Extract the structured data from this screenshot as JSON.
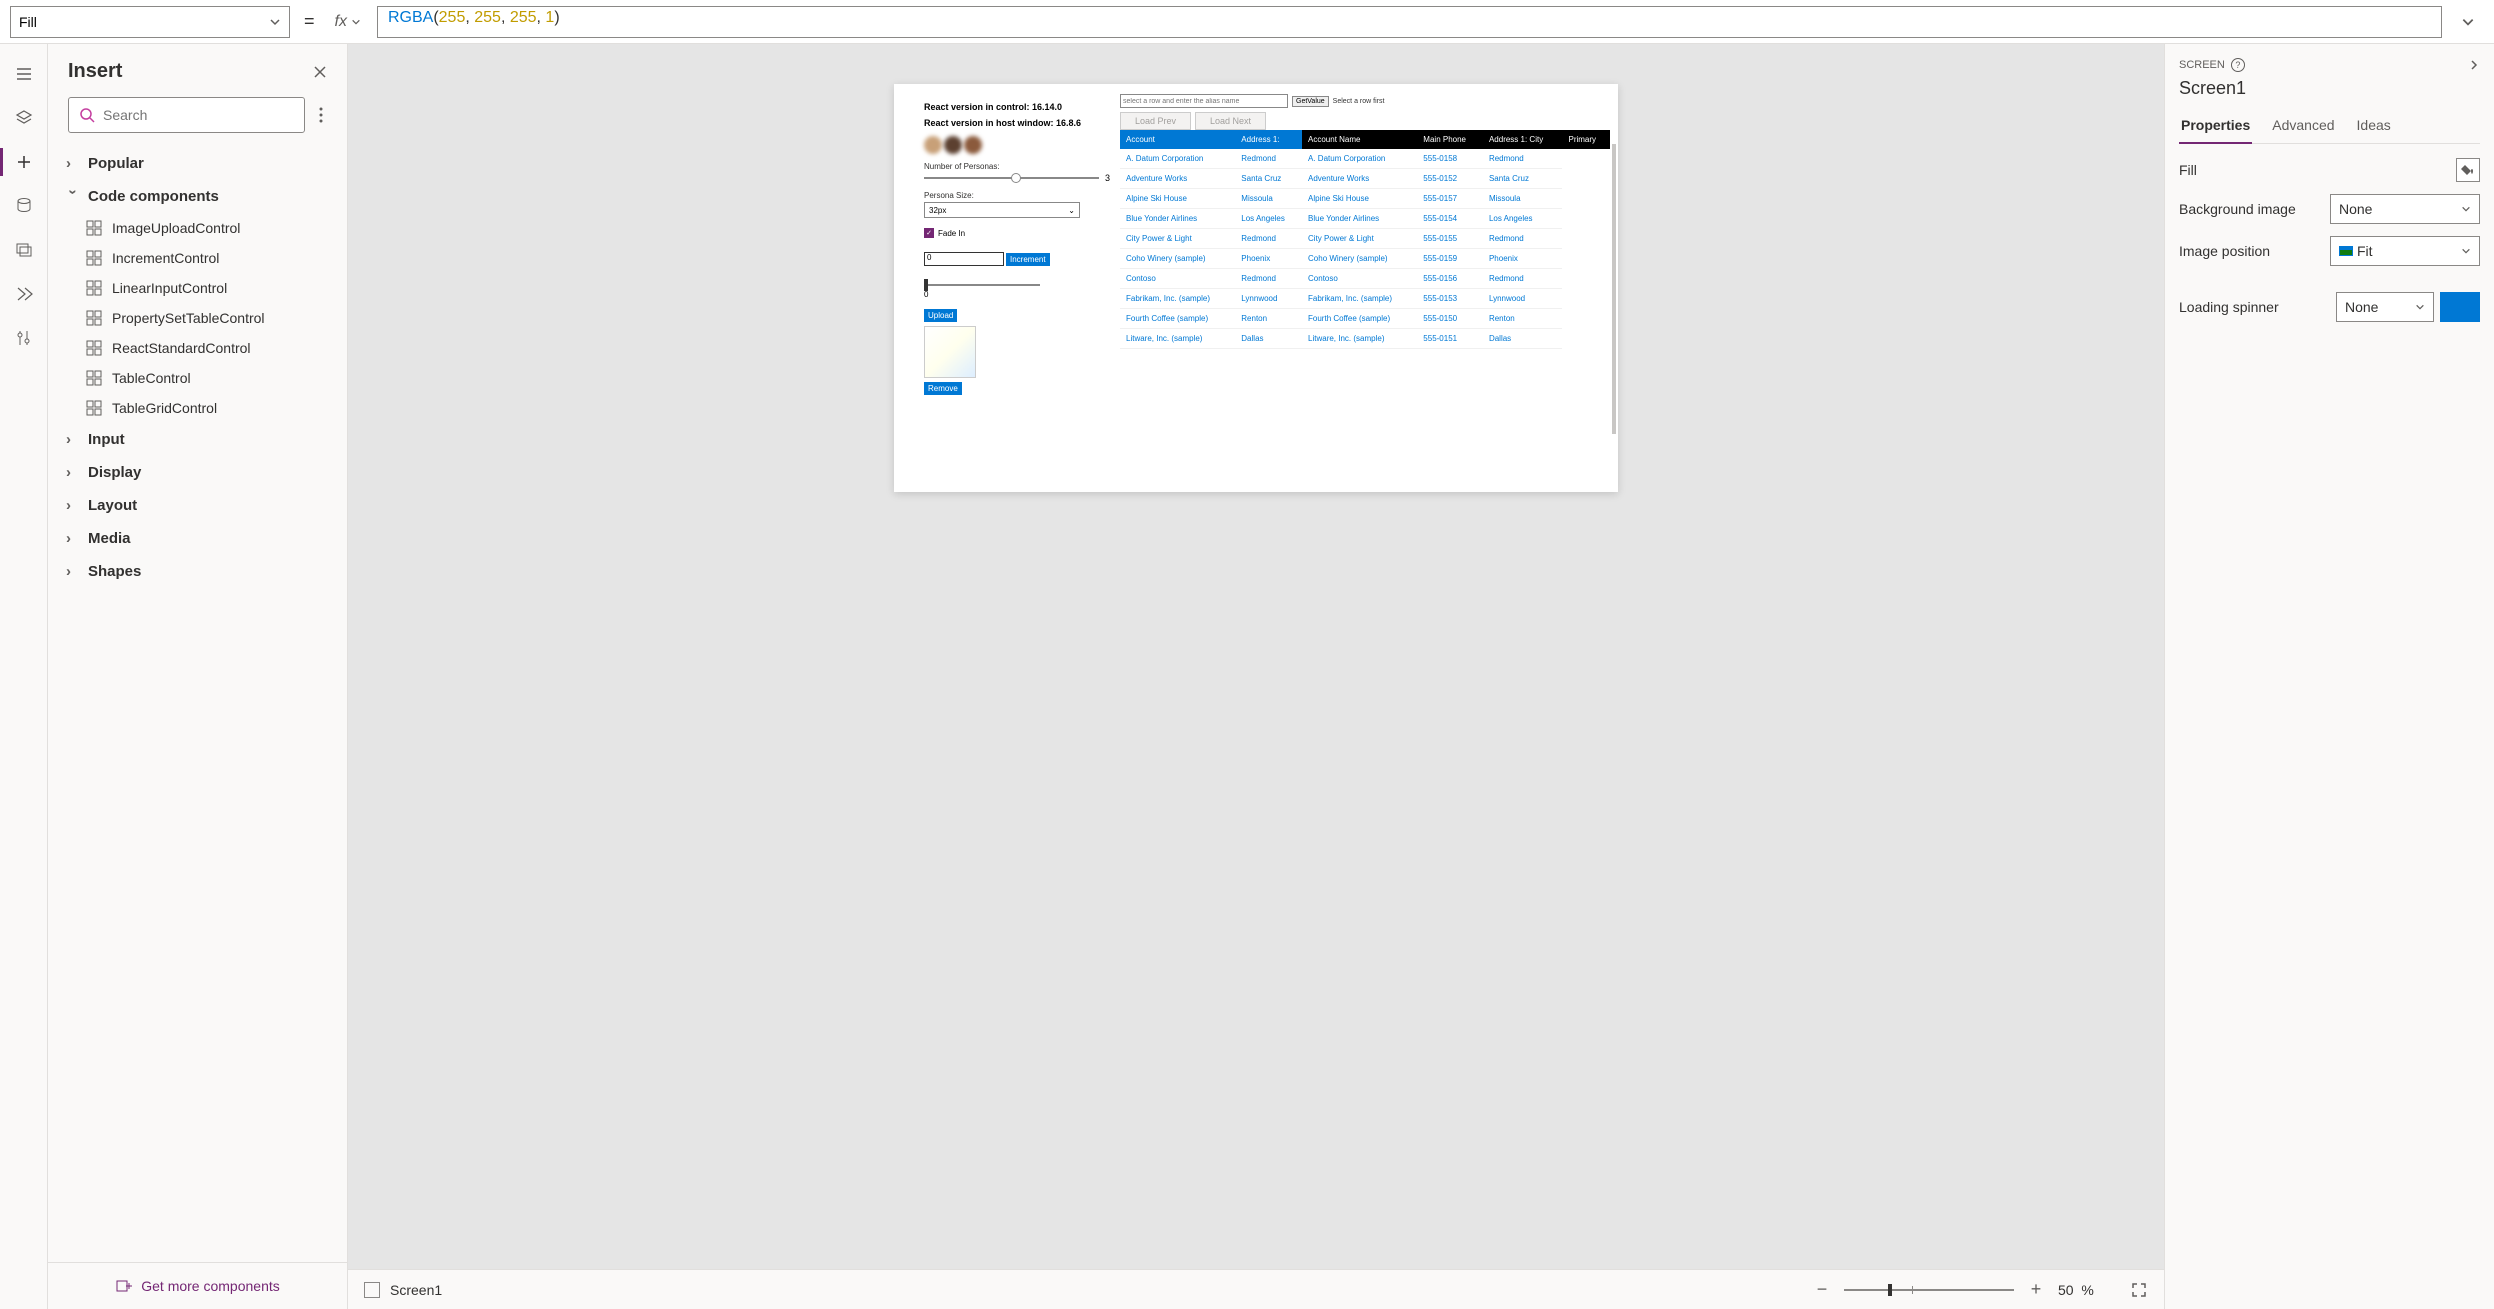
{
  "formula": {
    "property": "Fill",
    "fx_label": "fx",
    "code_fn": "RGBA",
    "code_args": [
      "255",
      "255",
      "255",
      "1"
    ]
  },
  "insert_panel": {
    "title": "Insert",
    "search_placeholder": "Search",
    "groups": {
      "popular": "Popular",
      "code_components": "Code components",
      "input": "Input",
      "display": "Display",
      "layout": "Layout",
      "media": "Media",
      "shapes": "Shapes"
    },
    "components": [
      "ImageUploadControl",
      "IncrementControl",
      "LinearInputControl",
      "PropertySetTableControl",
      "ReactStandardControl",
      "TableControl",
      "TableGridControl"
    ],
    "footer": "Get more components"
  },
  "canvas": {
    "left": {
      "react_control": "React version in control: 16.14.0",
      "react_host": "React version in host window: 16.8.6",
      "num_personas_label": "Number of Personas:",
      "num_personas_value": "3",
      "persona_size_label": "Persona Size:",
      "persona_size_value": "32px",
      "fade_in_label": "Fade In",
      "num_input_value": "0",
      "increment_btn": "Increment",
      "slider2_value": "0",
      "upload_btn": "Upload",
      "remove_btn": "Remove"
    },
    "right": {
      "alias_placeholder": "select a row and enter the alias name",
      "getvalue_btn": "GetValue",
      "hint": "Select a row first",
      "load_prev": "Load Prev",
      "load_next": "Load Next",
      "headers": [
        "Account",
        "Address 1:",
        "Account Name",
        "Main Phone",
        "Address 1: City",
        "Primary"
      ],
      "rows": [
        [
          "A. Datum Corporation",
          "Redmond",
          "A. Datum Corporation",
          "555-0158",
          "Redmond"
        ],
        [
          "Adventure Works",
          "Santa Cruz",
          "Adventure Works",
          "555-0152",
          "Santa Cruz"
        ],
        [
          "Alpine Ski House",
          "Missoula",
          "Alpine Ski House",
          "555-0157",
          "Missoula"
        ],
        [
          "Blue Yonder Airlines",
          "Los Angeles",
          "Blue Yonder Airlines",
          "555-0154",
          "Los Angeles"
        ],
        [
          "City Power & Light",
          "Redmond",
          "City Power & Light",
          "555-0155",
          "Redmond"
        ],
        [
          "Coho Winery (sample)",
          "Phoenix",
          "Coho Winery (sample)",
          "555-0159",
          "Phoenix"
        ],
        [
          "Contoso",
          "Redmond",
          "Contoso",
          "555-0156",
          "Redmond"
        ],
        [
          "Fabrikam, Inc. (sample)",
          "Lynnwood",
          "Fabrikam, Inc. (sample)",
          "555-0153",
          "Lynnwood"
        ],
        [
          "Fourth Coffee (sample)",
          "Renton",
          "Fourth Coffee (sample)",
          "555-0150",
          "Renton"
        ],
        [
          "Litware, Inc. (sample)",
          "Dallas",
          "Litware, Inc. (sample)",
          "555-0151",
          "Dallas"
        ]
      ]
    },
    "status": {
      "screen_name": "Screen1",
      "zoom_pct": "50",
      "zoom_unit": "%"
    }
  },
  "props": {
    "type_label": "SCREEN",
    "name": "Screen1",
    "tabs": {
      "properties": "Properties",
      "advanced": "Advanced",
      "ideas": "Ideas"
    },
    "fill_label": "Fill",
    "bg_image_label": "Background image",
    "bg_image_value": "None",
    "image_pos_label": "Image position",
    "image_pos_value": "Fit",
    "spinner_label": "Loading spinner",
    "spinner_value": "None",
    "spinner_color": "#0078d4"
  }
}
